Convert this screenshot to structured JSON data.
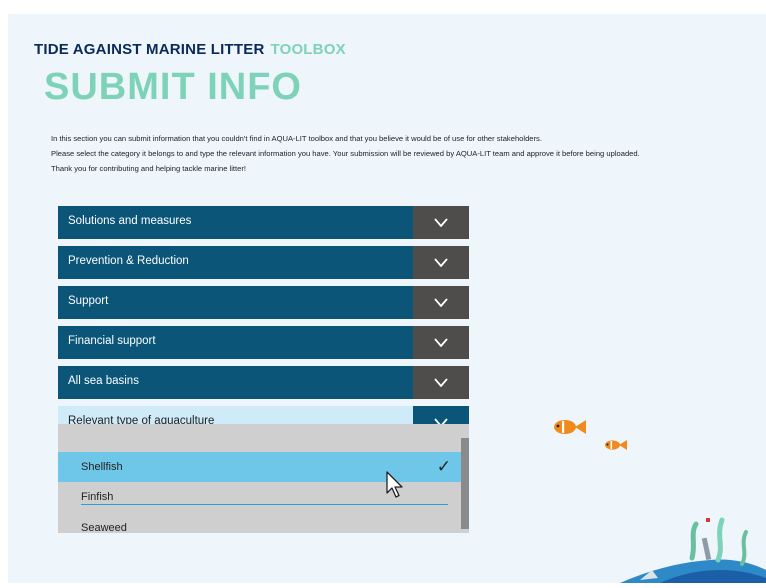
{
  "brand": {
    "main": "TIDE AGAINST MARINE LITTER",
    "sub": "TOOLBOX"
  },
  "page_title": "SUBMIT INFO",
  "intro": [
    "In this section you can submit information that you couldn't find in AQUA-LIT toolbox and that you believe it would be of use for other stakeholders.",
    "Please select the category it belongs to and type the relevant information you have. Your submission will be reviewed by AQUA-LIT team and approve it before being uploaded.",
    "Thank you for contributing and helping tackle marine litter!"
  ],
  "accordions": [
    {
      "label": "Solutions and measures"
    },
    {
      "label": "Prevention & Reduction"
    },
    {
      "label": "Support"
    },
    {
      "label": "Financial support"
    },
    {
      "label": "All sea basins"
    },
    {
      "label": "Relevant type of aquaculture"
    }
  ],
  "dropdown": {
    "options": [
      "Shellfish",
      "Finfish",
      "Seaweed"
    ],
    "selected": "Shellfish",
    "check_glyph": "✓"
  },
  "icons": {
    "chevron": "chevron-down-icon",
    "cursor": "mouse-pointer-icon",
    "check": "checkmark-icon"
  },
  "colors": {
    "brand_navy": "#0a2a5a",
    "accent_mint": "#7ed2b8",
    "bar_blue": "#0a5578",
    "chevron_gray": "#4e4d4c",
    "selected_blue": "#6ec6e8",
    "open_bar": "#cfeaf8"
  }
}
